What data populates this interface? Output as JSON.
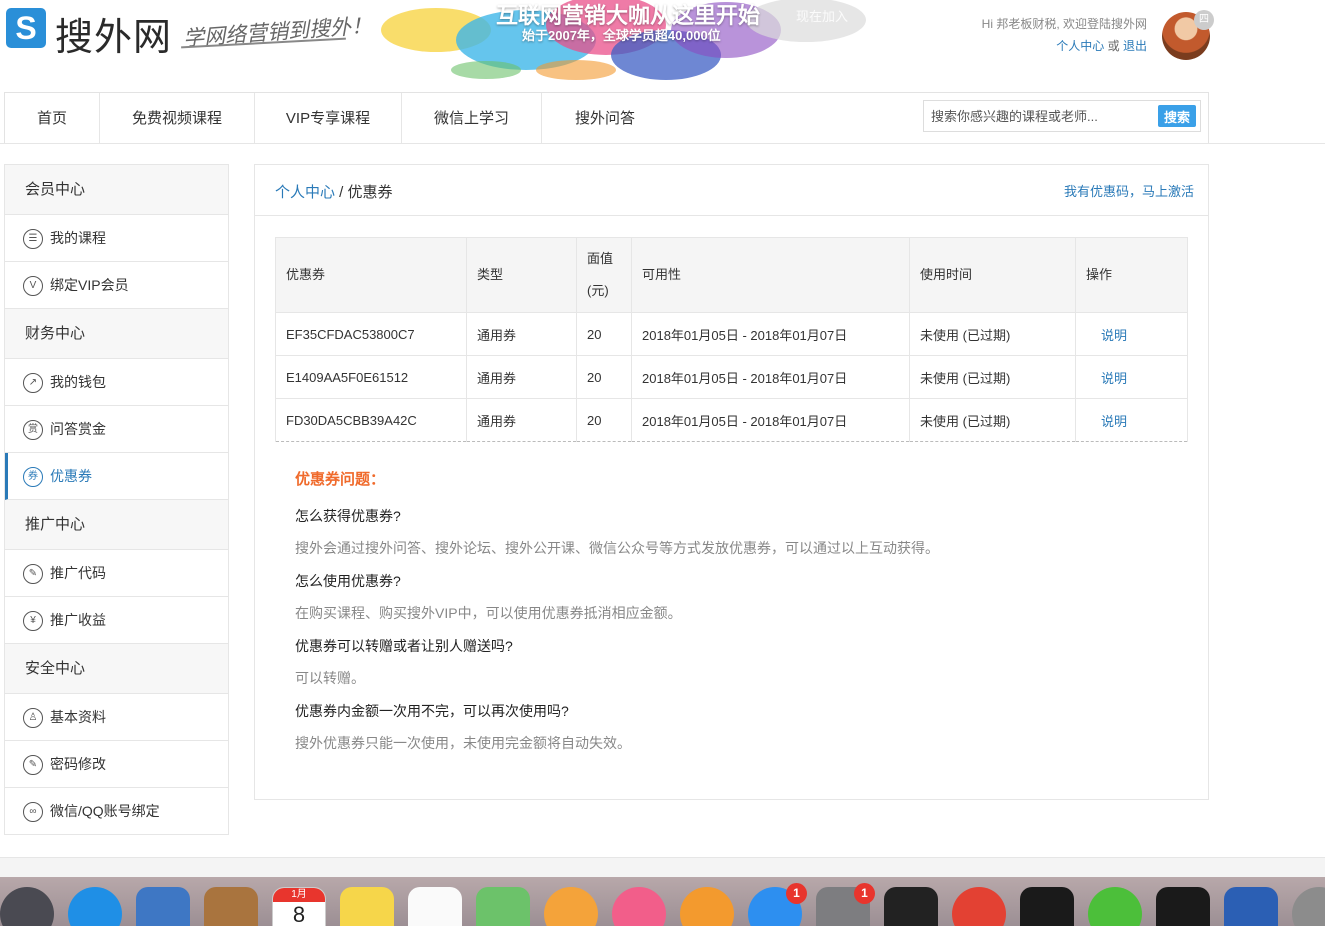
{
  "header": {
    "logo_letter": "S",
    "logo_text": "搜外网",
    "slogan": "学网络营销到搜外！",
    "banner_title": "互联网营销大咖从这里开始",
    "banner_subtitle": "始于2007年，全球学员超40,000位",
    "banner_join": "现在加入",
    "greeting": "Hi 邦老板财税, 欢迎登陆搜外网",
    "user_center": "个人中心",
    "or": "或",
    "logout": "退出",
    "avatar_badge": "四"
  },
  "nav": {
    "items": [
      "首页",
      "免费视频课程",
      "VIP专享课程",
      "微信上学习",
      "搜外问答"
    ],
    "search_placeholder": "搜索你感兴趣的课程或老师...",
    "search_button": "搜索"
  },
  "sidebar": {
    "groups": [
      {
        "title": "会员中心",
        "items": [
          {
            "label": "我的课程",
            "icon": "list-icon",
            "glyph": "☰"
          },
          {
            "label": "绑定VIP会员",
            "icon": "vip-icon",
            "glyph": "V"
          }
        ]
      },
      {
        "title": "财务中心",
        "items": [
          {
            "label": "我的钱包",
            "icon": "wallet-trend-icon",
            "glyph": "↗"
          },
          {
            "label": "问答赏金",
            "icon": "reward-icon",
            "glyph": "赏"
          },
          {
            "label": "优惠券",
            "icon": "coupon-icon",
            "glyph": "券"
          }
        ]
      },
      {
        "title": "推广中心",
        "items": [
          {
            "label": "推广代码",
            "icon": "pencil-icon",
            "glyph": "✎"
          },
          {
            "label": "推广收益",
            "icon": "yen-icon",
            "glyph": "¥"
          }
        ]
      },
      {
        "title": "安全中心",
        "items": [
          {
            "label": "基本资料",
            "icon": "user-icon",
            "glyph": "♙"
          },
          {
            "label": "密码修改",
            "icon": "password-icon",
            "glyph": "✎"
          },
          {
            "label": "微信/QQ账号绑定",
            "icon": "link-icon",
            "glyph": "∞"
          }
        ]
      }
    ],
    "active": "优惠券"
  },
  "main": {
    "breadcrumb_link": "个人中心",
    "breadcrumb_sep": " / ",
    "breadcrumb_current": "优惠券",
    "activate_link": "我有优惠码，马上激活",
    "table": {
      "headers": [
        "优惠券",
        "类型",
        "面值(元)",
        "可用性",
        "使用时间",
        "操作"
      ],
      "header_value_line1": "面值",
      "header_value_line2": "(元)",
      "rows": [
        [
          "EF35CFDAC53800C7",
          "通用券",
          "20",
          "2018年01月05日 - 2018年01月07日",
          "未使用 (已过期)",
          "说明"
        ],
        [
          "E1409AA5F0E61512",
          "通用券",
          "20",
          "2018年01月05日 - 2018年01月07日",
          "未使用 (已过期)",
          "说明"
        ],
        [
          "FD30DA5CBB39A42C",
          "通用券",
          "20",
          "2018年01月05日 - 2018年01月07日",
          "未使用 (已过期)",
          "说明"
        ]
      ]
    },
    "faq": {
      "title": "优惠券问题：",
      "items": [
        {
          "q": "怎么获得优惠券?",
          "a": "搜外会通过搜外问答、搜外论坛、搜外公开课、微信公众号等方式发放优惠券，可以通过以上互动获得。"
        },
        {
          "q": "怎么使用优惠券?",
          "a": "在购买课程、购买搜外VIP中，可以使用优惠券抵消相应金额。"
        },
        {
          "q": "优惠券可以转赠或者让别人赠送吗?",
          "a": "可以转赠。"
        },
        {
          "q": "优惠券内金额一次用不完，可以再次使用吗?",
          "a": "搜外优惠券只能一次使用，未使用完金额将自动失效。"
        }
      ]
    }
  },
  "dock": {
    "icons": [
      {
        "name": "launchpad-icon",
        "color": "#4a4a52"
      },
      {
        "name": "safari-icon",
        "color": "#1f8fe6"
      },
      {
        "name": "mail-stamp-icon",
        "color": "#3e77c4"
      },
      {
        "name": "contacts-icon",
        "color": "#a9743e"
      },
      {
        "name": "calendar-icon",
        "color": "#ffffff"
      },
      {
        "name": "notes-icon",
        "color": "#f6d64a"
      },
      {
        "name": "reminders-icon",
        "color": "#fafafa"
      },
      {
        "name": "maps-icon",
        "color": "#6cc26a"
      },
      {
        "name": "photos-icon",
        "color": "#f4a33a"
      },
      {
        "name": "itunes-icon",
        "color": "#f25e8a"
      },
      {
        "name": "ibooks-icon",
        "color": "#f39a2e"
      },
      {
        "name": "app-store-icon",
        "color": "#2d8ff0"
      },
      {
        "name": "system-preferences-icon",
        "color": "#7d7d80"
      },
      {
        "name": "terminal-icon",
        "color": "#222222"
      },
      {
        "name": "chrome-icon",
        "color": "#e34133"
      },
      {
        "name": "qq-icon",
        "color": "#1a1a1a"
      },
      {
        "name": "wechat-icon",
        "color": "#4cbf3a"
      },
      {
        "name": "qq-icon-2",
        "color": "#1a1a1a"
      },
      {
        "name": "word-icon",
        "color": "#2b5fb4"
      },
      {
        "name": "disk-utility-icon",
        "color": "#8c8c8c"
      }
    ],
    "calendar_month": "1月",
    "calendar_day": "8",
    "badge_count": "1"
  }
}
